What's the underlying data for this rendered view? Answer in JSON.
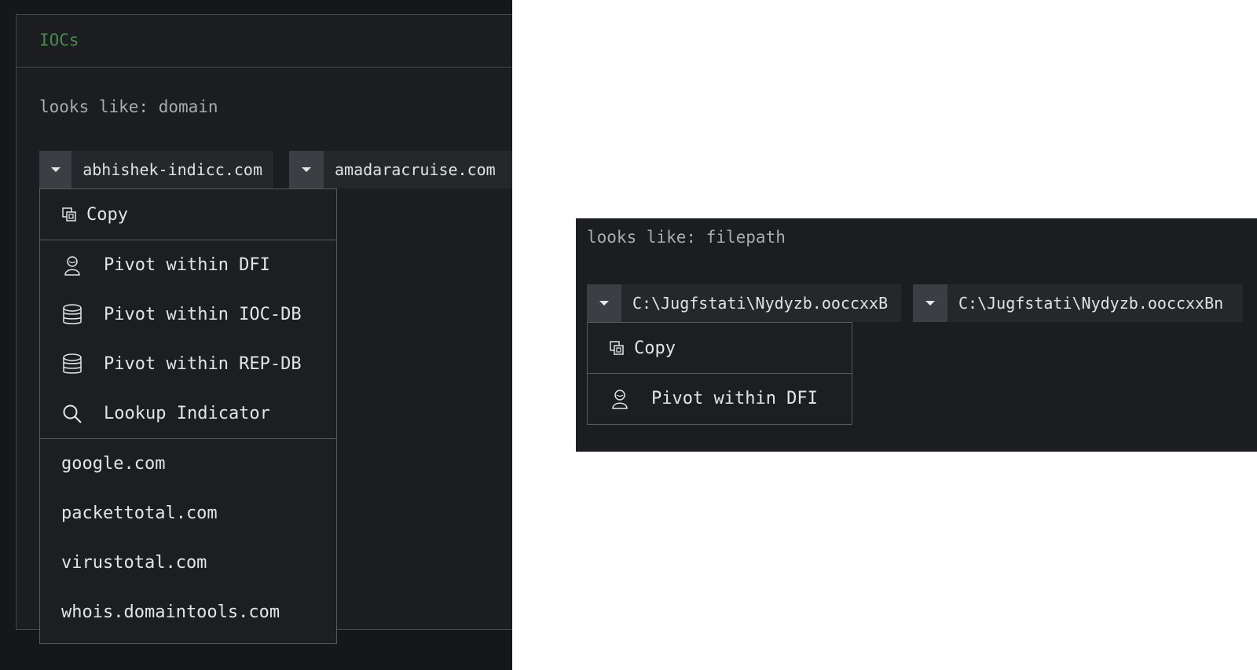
{
  "left": {
    "card_title": "IOCs",
    "type_label": "looks like: domain",
    "chips": [
      {
        "value": "abhishek-indicc.com"
      },
      {
        "value": "amadaracruise.com"
      }
    ],
    "menu": {
      "copy": "Copy",
      "actions": [
        {
          "icon": "user-icon",
          "label": "Pivot within DFI"
        },
        {
          "icon": "database-icon",
          "label": "Pivot within IOC-DB"
        },
        {
          "icon": "database-icon",
          "label": "Pivot within REP-DB"
        },
        {
          "icon": "search-icon",
          "label": "Lookup Indicator"
        }
      ],
      "links": [
        "google.com",
        "packettotal.com",
        "virustotal.com",
        "whois.domaintools.com"
      ]
    }
  },
  "right": {
    "type_label": "looks like: filepath",
    "chips": [
      {
        "value": "C:\\Jugfstati\\Nydyzb.ooccxxB"
      },
      {
        "value": "C:\\Jugfstati\\Nydyzb.ooccxxBn"
      }
    ],
    "menu": {
      "copy": "Copy",
      "actions": [
        {
          "icon": "user-icon",
          "label": "Pivot within DFI"
        }
      ]
    }
  },
  "colors": {
    "title_green": "#4b8a4f",
    "panel_bg": "#1b1d20",
    "chip_toggle": "#3c3e43"
  }
}
